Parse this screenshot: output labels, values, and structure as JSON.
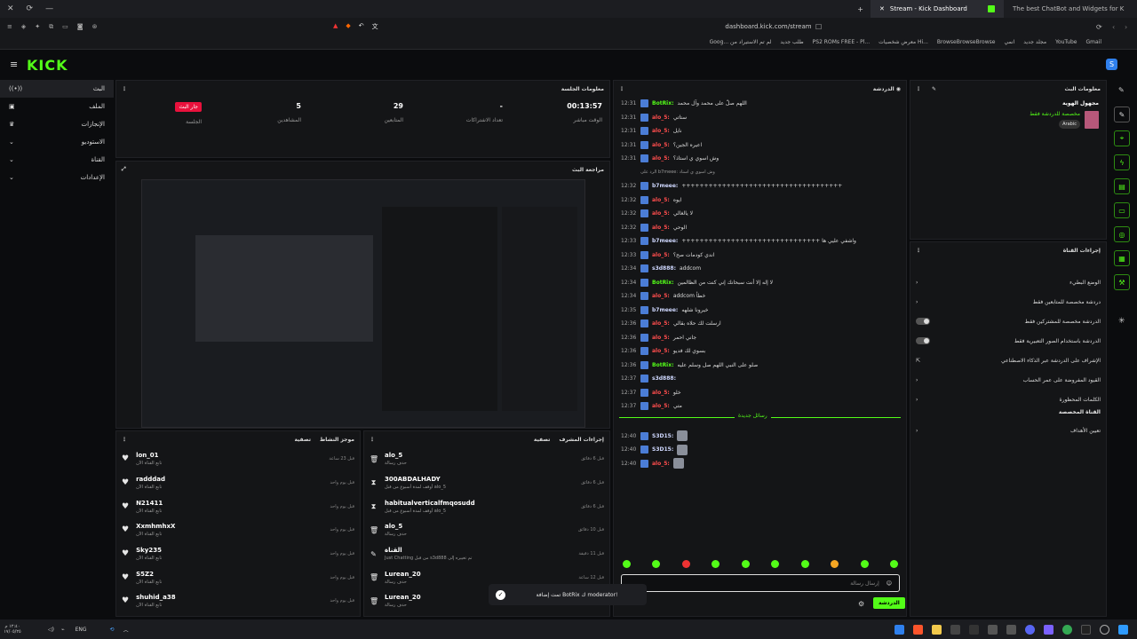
{
  "browser": {
    "tabs": [
      {
        "title": "Stream - Kick Dashboard",
        "active": true
      },
      {
        "title": "The best ChatBot and Widgets for K",
        "active": false
      }
    ],
    "url": "dashboard.kick.com/stream",
    "bookmarks": [
      "Gmail",
      "YouTube",
      "مجلد جديد",
      "انمي",
      "BrowseBrowseBrowse",
      "معرض شخصيات Hi...",
      "PS2 ROMs FREE - Pl...",
      "طلب جديد",
      "Goog... لم تم الاستيراد من"
    ]
  },
  "kick": {
    "logo": "KICK"
  },
  "sidebar": {
    "items": [
      {
        "label": "البث",
        "icon": "live-icon"
      },
      {
        "label": "الملف",
        "icon": "profile-icon"
      },
      {
        "label": "الإنجازات",
        "icon": "trophy-icon"
      },
      {
        "label": "الاستوديو",
        "icon": "studio-icon"
      },
      {
        "label": "القناة",
        "icon": "channel-icon"
      },
      {
        "label": "الإعدادات",
        "icon": "gear-icon"
      }
    ]
  },
  "session": {
    "title": "معلومات الجلسة",
    "live_badge": "جار البث",
    "session_label": "الجلسة",
    "stats": [
      {
        "value": "5",
        "label": "المشاهدين"
      },
      {
        "value": "29",
        "label": "المتابعين"
      },
      {
        "value": "-",
        "label": "تعداد الاشتراكات"
      },
      {
        "value": "00:13:57",
        "label": "الوقت مباشر"
      }
    ]
  },
  "preview": {
    "title": "مراجعة البث"
  },
  "chat": {
    "title": "الدردشة",
    "messages": [
      {
        "time": "12:31",
        "user": "BotRix:",
        "text": "اللهم صلّ على محمد وآل محمد",
        "color": "#53fc18"
      },
      {
        "time": "12:31",
        "user": "alo_5:",
        "text": "ستاتي",
        "color": "#ff4d4d"
      },
      {
        "time": "12:31",
        "user": "alo_5:",
        "text": "نايل",
        "color": "#ff4d4d"
      },
      {
        "time": "12:31",
        "user": "alo_5:",
        "text": "اعيره الجين؟",
        "color": "#ff4d4d"
      },
      {
        "time": "12:31",
        "user": "alo_5:",
        "text": "وش اسوي ي استاذ؟",
        "color": "#ff4d4d"
      },
      {
        "time": "",
        "user": "",
        "text": "الرد على b7meee: وش اسوي ي استاذ",
        "color": "#999"
      },
      {
        "time": "12:32",
        "user": "b7meee:",
        "text": "++++++++++++++++++++++++++++++++++++",
        "color": "#cfd8ff"
      },
      {
        "time": "12:32",
        "user": "alo_5:",
        "text": "ايوه",
        "color": "#ff4d4d"
      },
      {
        "time": "12:32",
        "user": "alo_5:",
        "text": "لا يالغالي",
        "color": "#ff4d4d"
      },
      {
        "time": "12:32",
        "user": "alo_5:",
        "text": "الوحي",
        "color": "#ff4d4d"
      },
      {
        "time": "12:33",
        "user": "b7meee:",
        "text": "+++++++++++++++++++++++++++++++ واشفي عليي ها",
        "color": "#cfd8ff"
      },
      {
        "time": "12:33",
        "user": "alo_5:",
        "text": "اندي كودمات صح؟",
        "color": "#ff4d4d"
      },
      {
        "time": "12:34",
        "user": "s3d888:",
        "text": "addcom",
        "color": "#cfd8ff"
      },
      {
        "time": "12:34",
        "user": "BotRix:",
        "text": "لا إله إلا أنت سبحانك إني كنت من الظالمين",
        "color": "#53fc18"
      },
      {
        "time": "12:34",
        "user": "alo_5:",
        "text": "addcom خطأ",
        "color": "#ff4d4d"
      },
      {
        "time": "12:35",
        "user": "b7meee:",
        "text": "خيرونا شلهه",
        "color": "#cfd8ff"
      },
      {
        "time": "12:36",
        "user": "alo_5:",
        "text": "ارسلت لك حلاه بقالي",
        "color": "#ff4d4d"
      },
      {
        "time": "12:36",
        "user": "alo_5:",
        "text": "جاني احمر",
        "color": "#ff4d4d"
      },
      {
        "time": "12:36",
        "user": "alo_5:",
        "text": "بسوي لك فديو",
        "color": "#ff4d4d"
      },
      {
        "time": "12:36",
        "user": "BotRix:",
        "text": "صلو على النبي اللهم صل وسلم عليه",
        "color": "#53fc18"
      },
      {
        "time": "12:37",
        "user": "s3d888:",
        "text": "",
        "color": "#cfd8ff"
      },
      {
        "time": "12:37",
        "user": "alo_5:",
        "text": "خلو",
        "color": "#ff4d4d"
      },
      {
        "time": "12:37",
        "user": "alo_5:",
        "text": "متي",
        "color": "#ff4d4d"
      }
    ],
    "new_messages_label": "رسائل جديدة",
    "recent": [
      {
        "time": "12:40",
        "user": "S3D15:",
        "color": "#cfd8ff"
      },
      {
        "time": "12:40",
        "user": "S3D15:",
        "color": "#cfd8ff"
      },
      {
        "time": "12:40",
        "user": "alo_5:",
        "color": "#ff4d4d"
      }
    ],
    "input_placeholder": "إرسال رسالة",
    "send_label": "الدردشة"
  },
  "activity": {
    "title": "موجز النشاط",
    "filter": "تصفية",
    "items": [
      {
        "name": "lon_01",
        "sub": "تابع القناة الآن",
        "time": "قبل 23 ساعة"
      },
      {
        "name": "radddad",
        "sub": "تابع القناة الآن",
        "time": "قبل يوم واحد"
      },
      {
        "name": "N21411",
        "sub": "تابع القناة الآن",
        "time": "قبل يوم واحد"
      },
      {
        "name": "XxmhmhxX",
        "sub": "تابع القناة الآن",
        "time": "قبل يوم واحد"
      },
      {
        "name": "Sky235",
        "sub": "تابع القناة الآن",
        "time": "قبل يوم واحد"
      },
      {
        "name": "S5Z2",
        "sub": "تابع القناة الآن",
        "time": "قبل يوم واحد"
      },
      {
        "name": "shuhid_a38",
        "sub": "تابع القناة الآن",
        "time": "قبل يوم واحد"
      }
    ]
  },
  "modlog": {
    "title": "إجراءات المشرف",
    "filter": "تصفية",
    "items": [
      {
        "name": "alo_5",
        "sub": "حذف رسالة",
        "time": "قبل 6 دقائق",
        "icon": "trash-icon"
      },
      {
        "name": "300ABDALHADY",
        "sub": "أوقف لمدة أسبوع من قبل alo_5",
        "time": "قبل 6 دقائق",
        "icon": "timeout-icon"
      },
      {
        "name": "habitualverticalfmqosudd",
        "sub": "أوقف لمدة أسبوع من قبل alo_5",
        "time": "قبل 6 دقائق",
        "icon": "timeout-icon"
      },
      {
        "name": "alo_5",
        "sub": "حذف رسالة",
        "time": "قبل 10 دقائق",
        "icon": "trash-icon"
      },
      {
        "name": "القناة",
        "sub": "Just Chatting من قبل s3d888 تم تغييره إلى",
        "time": "قبل 11 دقيقة",
        "icon": "edit-icon"
      },
      {
        "name": "Lurean_20",
        "sub": "حذف رسالة",
        "time": "قبل 12 ساعة",
        "icon": "trash-icon"
      },
      {
        "name": "Lurean_20",
        "sub": "حذف رسالة",
        "time": "",
        "icon": "trash-icon"
      }
    ]
  },
  "stream_info": {
    "title": "معلومات البث",
    "stream_title": "مجهول الهوية",
    "subtitle": "مخصصة للدردشة فقط",
    "language": "Arabic"
  },
  "channel_actions": {
    "title": "إجراءات القناة",
    "rows": [
      {
        "label": "الوضع البطيء",
        "control": "chevron"
      },
      {
        "label": "دردشة مخصصة للمتابعين فقط",
        "control": "chevron"
      },
      {
        "label": "الدردشة مخصصة للمشتركين فقط",
        "control": "toggle"
      },
      {
        "label": "الدردشة باستخدام الصور التعبيرية فقط",
        "control": "toggle"
      },
      {
        "label": "الإشراف على الدردشة عبر الذكاء الاصطناعي",
        "control": "external"
      },
      {
        "label": "القيود المفروضة على عمر الحساب",
        "control": "chevron"
      },
      {
        "label": "الكلمات المحظورة",
        "control": "chevron"
      }
    ],
    "section": "القناة المخصصة",
    "goals": "تعيين الأهداف"
  },
  "toast": {
    "text": "تمت إضافة BotRix ك moderator!"
  },
  "taskbar": {
    "lang": "ENG",
    "time": "١٢:٤٠ م",
    "date": "١٧/٠٥/٢٥"
  }
}
